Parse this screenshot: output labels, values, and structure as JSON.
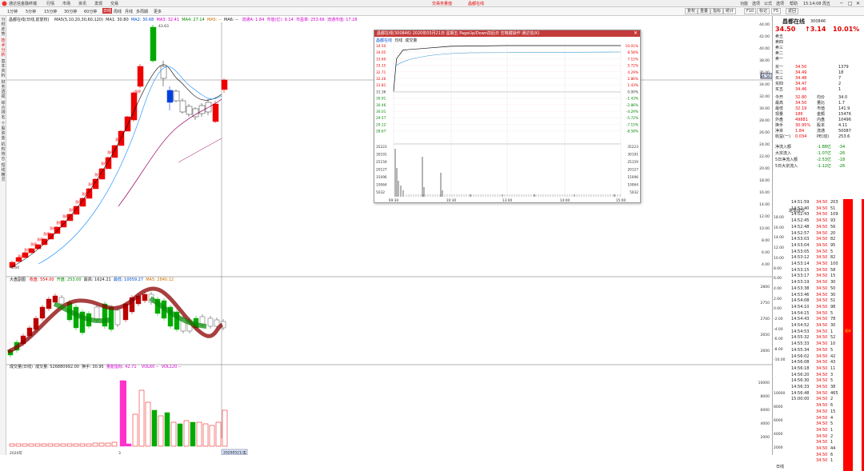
{
  "menu": {
    "app_title": "通达信金融终端",
    "items": [
      "行情",
      "市场",
      "资讯",
      "发现",
      "交易"
    ],
    "center_items": [
      "交易务量值",
      "昌都在线"
    ],
    "right_items": [
      "功能",
      "选项",
      "公式",
      "选项",
      "帮助"
    ],
    "time": "15:14:08 周五"
  },
  "toolbar": {
    "periods": [
      "1分钟",
      "5分钟",
      "15分钟",
      "30分钟",
      "60分钟",
      "日线",
      "周线",
      "月线",
      "多周期",
      "更多"
    ],
    "right_buttons": [
      "复权",
      "重叠",
      "指标",
      "统计",
      "F10",
      "标记",
      "F5",
      "返回"
    ]
  },
  "sidebar": {
    "tabs": [
      "分时走势",
      "技术分析",
      "基本资料",
      "财务透视",
      "综合排名",
      "个股资金",
      "机构持仓",
      "短线精灵",
      "行业板块",
      "大盘"
    ]
  },
  "main_chart": {
    "legend_ma": "MA5(5,10,20,30,60,120)",
    "ma1": "MA1: 30.80",
    "ma2": "MA2: 30.68",
    "ma3": "MA3: 32.41",
    "ma4": "MA4: 27.14",
    "ma5": "MA5: --",
    "ma6": "MA6: --",
    "info1": "流通A: 1.84",
    "info2": "市值(亿): 9.14",
    "info3": "市盈率: 253.66",
    "info4": "流通市值: 17.28",
    "stock_label": "昌都在线(日线,前复权)",
    "high_label": "43.63",
    "low_label": "4.04",
    "price_tag": "34.50",
    "limit_labels": [
      "涨停",
      "涨停",
      "涨停",
      "涨停",
      "涨停",
      "涨停",
      "涨停",
      "涨停",
      "涨停",
      "涨停",
      "涨停",
      "涨停",
      "涨停",
      "涨停",
      "涨停",
      "涨停",
      "涨停"
    ],
    "yaxis": [
      "44.00",
      "42.00",
      "40.00",
      "38.00",
      "36.00",
      "34.00",
      "32.00",
      "30.00",
      "28.00",
      "26.00",
      "24.00",
      "22.00",
      "20.00",
      "18.00",
      "16.00",
      "14.00",
      "12.00",
      "10.00",
      "8.00",
      "6.00",
      "4.00"
    ]
  },
  "index_chart": {
    "title": "大盘副图",
    "vals": [
      "收盘: 554.00",
      "开盘: 253.00",
      "最高: 1624.21",
      "最低: 10059.27",
      "MA5: 2840.12"
    ],
    "yaxis": [
      "2800",
      "2750",
      "2700",
      "2650",
      "2600"
    ]
  },
  "vol_chart": {
    "title": "成交量(日线)",
    "vals": [
      "成交量: 526880992.00",
      "换手: 30.95",
      "量能指标: 42.71"
    ],
    "legend2": [
      "VOL60 --",
      "VOL120 --"
    ],
    "yaxis": [
      "10000",
      "8000",
      "6000",
      "4000",
      "2000"
    ],
    "date_label": "20200521/五"
  },
  "xaxis": {
    "labels": [
      "2020年",
      "3"
    ]
  },
  "dialog": {
    "title": "昌都在线(300846) 2020年05月21日 星期五 PageUp/Down前后日 空格键操作 通达信(K)",
    "tabs": [
      "昌都在线",
      "均线",
      "成交量"
    ],
    "left_axis": [
      "34.50",
      "34.05",
      "33.60",
      "33.15",
      "32.71",
      "32.26",
      "31.81",
      "31.36",
      "30.91",
      "30.46",
      "30.01",
      "29.57",
      "29.12",
      "28.67",
      "35223",
      "30191",
      "25159",
      "20127",
      "15096",
      "10064",
      "5032"
    ],
    "right_axis": [
      "10.01%",
      "8.58%",
      "7.15%",
      "5.72%",
      "4.29%",
      "2.86%",
      "1.43%",
      "0.00%",
      "-1.43%",
      "-2.86%",
      "-4.29%",
      "-5.72%",
      "-7.15%",
      "-8.58%",
      "35223",
      "30191",
      "25159",
      "20127",
      "15096",
      "10064",
      "5032"
    ],
    "time_axis": [
      "09:30",
      "10:30",
      "13:00",
      "14:00",
      "15:00"
    ],
    "prices": [
      {
        "time": "09:30",
        "price": 31.4
      },
      {
        "time": "09:33",
        "price": 33.6
      },
      {
        "time": "09:40",
        "price": 34.2
      },
      {
        "time": "10:00",
        "price": 34.3
      },
      {
        "time": "10:30",
        "price": 34.45
      },
      {
        "time": "11:30",
        "price": 34.5
      },
      {
        "time": "13:00",
        "price": 34.5
      },
      {
        "time": "15:00",
        "price": 34.5
      }
    ]
  },
  "quote": {
    "name": "昌都在线",
    "code": "300846",
    "price": "34.50",
    "change": "↑3.14",
    "pct": "10.01%",
    "asks": [
      [
        "卖五",
        "",
        ""
      ],
      [
        "卖四",
        "",
        ""
      ],
      [
        "卖三",
        "",
        ""
      ],
      [
        "卖二",
        "",
        ""
      ],
      [
        "卖一",
        "",
        ""
      ]
    ],
    "bids": [
      [
        "买一",
        "34.50",
        "1379"
      ],
      [
        "买二",
        "34.49",
        "18"
      ],
      [
        "买三",
        "34.48",
        "7"
      ],
      [
        "买四",
        "34.47",
        "2"
      ],
      [
        "买五",
        "34.46",
        "1"
      ]
    ],
    "stats": [
      [
        "今开",
        "32.80",
        "均价",
        "34.0"
      ],
      [
        "最高",
        "34.50",
        "量比",
        "1.7"
      ],
      [
        "最低",
        "32.19",
        "市值",
        "141.9"
      ],
      [
        "现量",
        "186",
        "金额",
        "15476"
      ],
      [
        "外盘",
        "49881",
        "内盘",
        "10496"
      ],
      [
        "换手",
        "30.95%",
        "股本",
        "4.11"
      ],
      [
        "净资",
        "1.84",
        "流通",
        "50087"
      ],
      [
        "收益(一)",
        "0.034",
        "PE(动)",
        "253.6"
      ]
    ],
    "flows": [
      [
        "净流入额",
        "-1.88亿",
        "-34"
      ],
      [
        "大宗流入",
        "-1.07亿",
        "-26"
      ],
      [
        "5日净流入额",
        "-2.53亿",
        "-18"
      ],
      [
        "5日大宗流入",
        "-1.12亿",
        "-26"
      ]
    ],
    "ticks_title": "逐笔成交",
    "ticks": [
      [
        "14:51:59",
        "34.50",
        "203"
      ],
      [
        "14:52:40",
        "34.50",
        "51"
      ],
      [
        "14:52:43",
        "34.50",
        "109"
      ],
      [
        "14:52:45",
        "34.50",
        "93"
      ],
      [
        "14:52:48",
        "34.50",
        "56"
      ],
      [
        "14:52:57",
        "34.50",
        "20"
      ],
      [
        "14:53:03",
        "34.50",
        "82"
      ],
      [
        "14:53:04",
        "34.50",
        "95"
      ],
      [
        "14:53:05",
        "34.50",
        "5"
      ],
      [
        "14:53:12",
        "34.50",
        "82"
      ],
      [
        "14:53:14",
        "34.50",
        "100"
      ],
      [
        "14:53:15",
        "34.50",
        "58"
      ],
      [
        "14:53:17",
        "34.50",
        "15"
      ],
      [
        "14:53:19",
        "34.50",
        "30"
      ],
      [
        "14:53:38",
        "34.50",
        "50"
      ],
      [
        "14:53:46",
        "34.50",
        "30"
      ],
      [
        "14:54:08",
        "34.50",
        "51"
      ],
      [
        "14:54:10",
        "34.50",
        "98"
      ],
      [
        "14:54:15",
        "34.50",
        "5"
      ],
      [
        "14:54:43",
        "34.50",
        "78"
      ],
      [
        "14:54:52",
        "34.50",
        "30"
      ],
      [
        "14:54:53",
        "34.50",
        "1"
      ],
      [
        "14:55:32",
        "34.50",
        "52"
      ],
      [
        "14:55:33",
        "34.50",
        "10"
      ],
      [
        "14:55:34",
        "34.50",
        "5"
      ],
      [
        "14:56:02",
        "34.50",
        "42"
      ],
      [
        "14:56:08",
        "34.50",
        "43"
      ],
      [
        "14:56:18",
        "34.50",
        "11"
      ],
      [
        "14:56:20",
        "34.50",
        "3"
      ],
      [
        "14:56:30",
        "34.50",
        "5"
      ],
      [
        "14:56:33",
        "34.50",
        "38"
      ],
      [
        "14:56:48",
        "34.50",
        "465"
      ],
      [
        "15:00:00",
        "34.50",
        "2"
      ],
      [
        "",
        "34.50",
        "6"
      ],
      [
        "",
        "34.50",
        "15"
      ],
      [
        "",
        "34.50",
        "4"
      ],
      [
        "",
        "34.50",
        "5"
      ],
      [
        "",
        "34.50",
        "1"
      ],
      [
        "",
        "34.50",
        "2"
      ],
      [
        "",
        "34.50",
        "1"
      ],
      [
        "",
        "34.50",
        "44"
      ],
      [
        "",
        "34.50",
        "6"
      ],
      [
        "",
        "34.50",
        "1"
      ]
    ],
    "tick_bar_label": "总计",
    "tick_axis": [
      "18.00",
      "16.00",
      "14.00",
      "12.00",
      "10.00",
      "8.00",
      "6.00",
      "4.00",
      "2.00",
      "0.00",
      "-2.00",
      "-4.00",
      "-6.00",
      "-8.00",
      "-10.00"
    ],
    "bottom_axis": [
      "10000",
      "8000",
      "6000",
      "4000",
      "2000"
    ],
    "bottom_btn": "日线"
  }
}
